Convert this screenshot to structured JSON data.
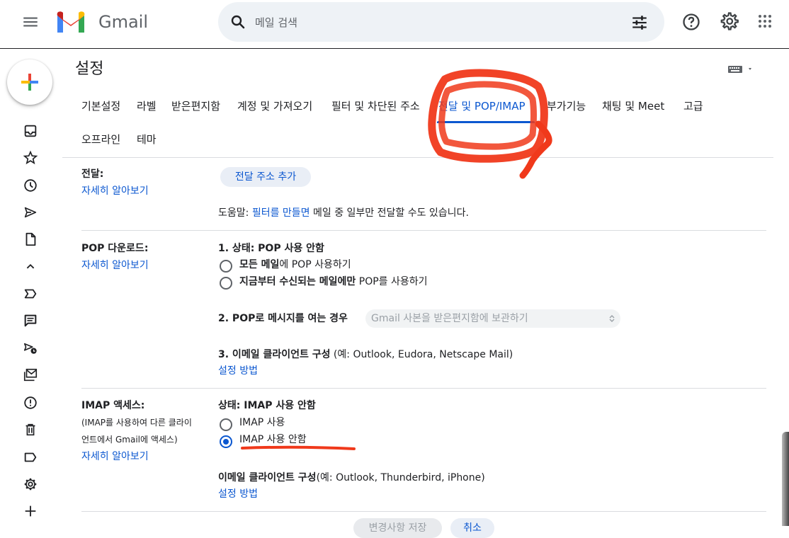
{
  "app": {
    "brand": "Gmail"
  },
  "search": {
    "placeholder": "메일 검색"
  },
  "settings": {
    "title": "설정",
    "tabs": [
      "기본설정",
      "라벨",
      "받은편지함",
      "계정 및 가져오기",
      "필터 및 차단된 주소",
      "전달 및 POP/IMAP",
      "부가기능",
      "채팅 및 Meet",
      "고급",
      "오프라인",
      "테마"
    ],
    "active_tab": "전달 및 POP/IMAP"
  },
  "forwarding": {
    "label": "전달:",
    "learn_more": "자세히 알아보기",
    "add_button": "전달 주소 추가",
    "help_prefix": "도움말: ",
    "help_link": "필터를 만들면",
    "help_suffix": " 메일 중 일부만 전달할 수도 있습니다."
  },
  "pop": {
    "label": "POP 다운로드:",
    "learn_more": "자세히 알아보기",
    "status": "1. 상태: POP 사용 안함",
    "option1_bold": "모든 메일",
    "option1_rest": "에 POP 사용하기",
    "option2_bold": "지금부터 수신되는 메일에만",
    "option2_rest": " POP를 사용하기",
    "when_label": "2. POP로 메시지를 여는 경우",
    "when_select": "Gmail 사본을 받은편지함에 보관하기",
    "client_bold": "3. 이메일 클라이언트 구성",
    "client_rest": " (예: Outlook, Eudora, Netscape Mail)",
    "setup_link": "설정 방법"
  },
  "imap": {
    "label": "IMAP 액세스:",
    "desc_line1": "(IMAP를 사용하여 다른 클라이",
    "desc_line2": "언트에서 Gmail에 액세스)",
    "learn_more": "자세히 알아보기",
    "status": "상태: IMAP 사용 안함",
    "option_on": "IMAP 사용",
    "option_off": "IMAP 사용 안함",
    "selected": "IMAP 사용 안함",
    "client_bold": "이메일 클라이언트 구성",
    "client_rest": "(예: Outlook, Thunderbird, iPhone)",
    "setup_link": "설정 방법"
  },
  "footer": {
    "save": "변경사항 저장",
    "cancel": "취소"
  },
  "colors": {
    "accent": "#0b57d0",
    "annotation": "#f0391b"
  },
  "icons": [
    "menu-icon",
    "gmail-logo",
    "search-icon",
    "tune-icon",
    "help-icon",
    "gear-icon",
    "apps-icon",
    "compose-plus-icon",
    "inbox-icon",
    "star-icon",
    "clock-icon",
    "send-icon",
    "draft-icon",
    "chevron-up-icon",
    "important-icon",
    "chat-icon",
    "scheduled-icon",
    "all-mail-icon",
    "spam-icon",
    "trash-icon",
    "label-icon",
    "manage-labels-icon",
    "add-icon",
    "keyboard-icon"
  ]
}
